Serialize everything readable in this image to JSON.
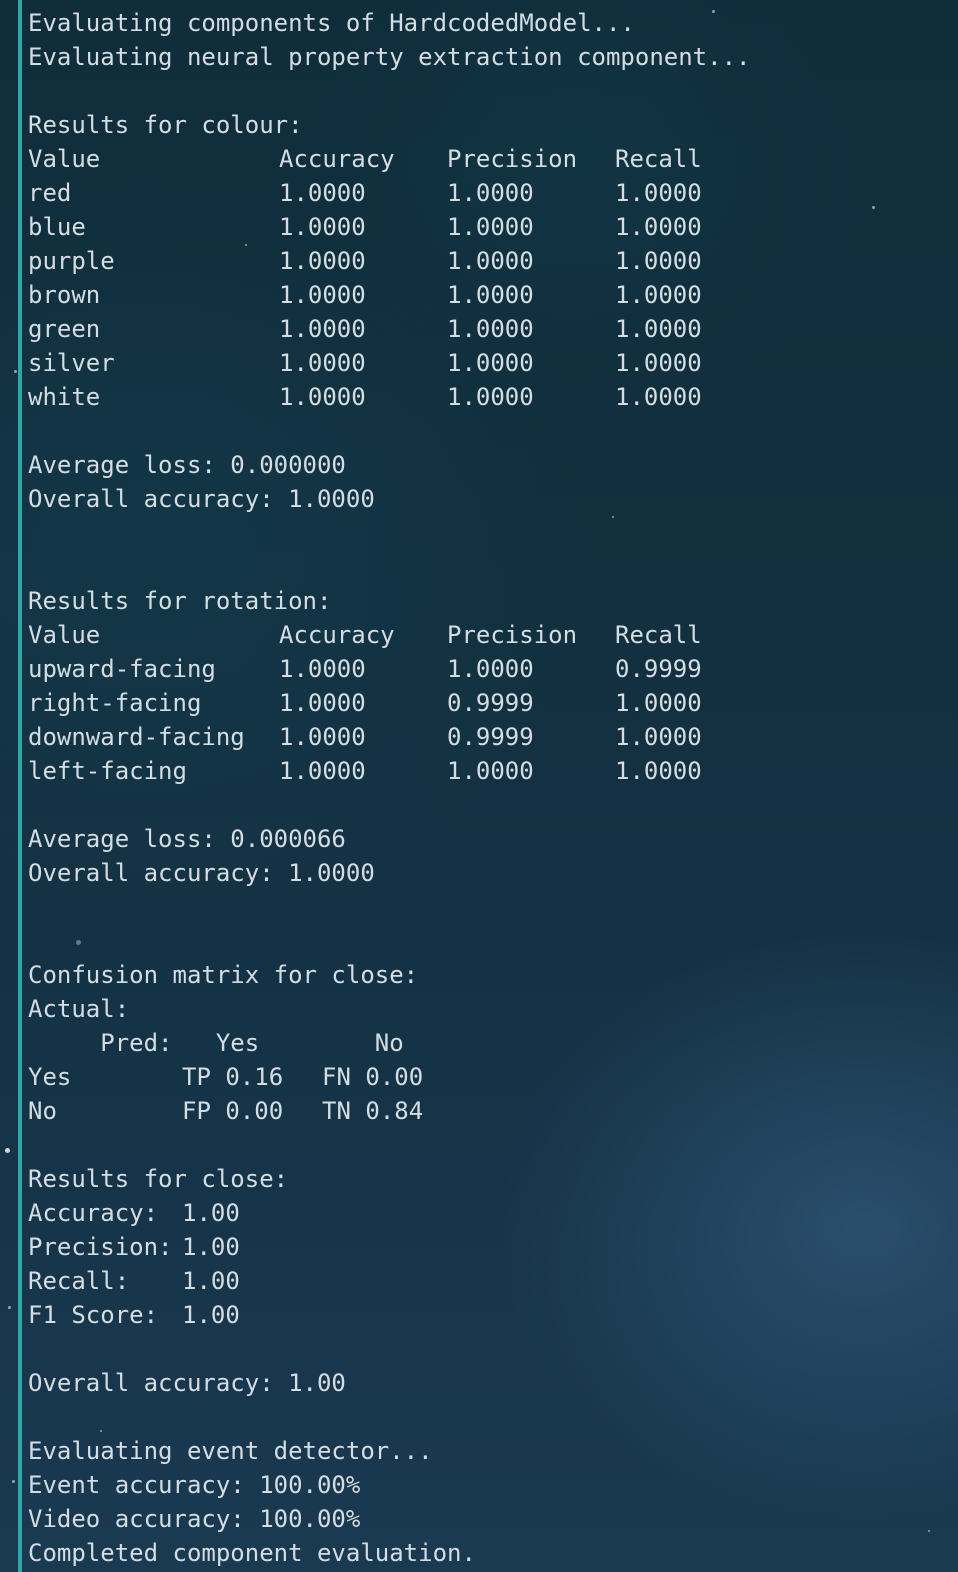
{
  "header": {
    "line1": "Evaluating components of HardcodedModel...",
    "line2": "Evaluating neural property extraction component..."
  },
  "colour": {
    "title": "Results for colour:",
    "columns": [
      "Value",
      "Accuracy",
      "Precision",
      "Recall"
    ],
    "rows": [
      [
        "red",
        "1.0000",
        "1.0000",
        "1.0000"
      ],
      [
        "blue",
        "1.0000",
        "1.0000",
        "1.0000"
      ],
      [
        "purple",
        "1.0000",
        "1.0000",
        "1.0000"
      ],
      [
        "brown",
        "1.0000",
        "1.0000",
        "1.0000"
      ],
      [
        "green",
        "1.0000",
        "1.0000",
        "1.0000"
      ],
      [
        "silver",
        "1.0000",
        "1.0000",
        "1.0000"
      ],
      [
        "white",
        "1.0000",
        "1.0000",
        "1.0000"
      ]
    ],
    "avg_loss": "Average loss: 0.000000",
    "overall": "Overall accuracy: 1.0000"
  },
  "rotation": {
    "title": "Results for rotation:",
    "columns": [
      "Value",
      "Accuracy",
      "Precision",
      "Recall"
    ],
    "rows": [
      [
        "upward-facing",
        "1.0000",
        "1.0000",
        "0.9999"
      ],
      [
        "right-facing",
        "1.0000",
        "0.9999",
        "1.0000"
      ],
      [
        "downward-facing",
        "1.0000",
        "0.9999",
        "1.0000"
      ],
      [
        "left-facing",
        "1.0000",
        "1.0000",
        "1.0000"
      ]
    ],
    "avg_loss": "Average loss: 0.000066",
    "overall": "Overall accuracy: 1.0000"
  },
  "confusion": {
    "title": "Confusion matrix for close:",
    "actual": "Actual:",
    "pred_header": "     Pred:   Yes        No",
    "rows": [
      [
        "Yes",
        "TP 0.16",
        "FN 0.00"
      ],
      [
        "No",
        "FP 0.00",
        "TN 0.84"
      ]
    ]
  },
  "close": {
    "title": "Results for close:",
    "metrics": [
      [
        "Accuracy:",
        "1.00"
      ],
      [
        "Precision:",
        "1.00"
      ],
      [
        "Recall:",
        "1.00"
      ],
      [
        "F1 Score:",
        "1.00"
      ]
    ],
    "overall": "Overall accuracy: 1.00"
  },
  "events": {
    "line1": "Evaluating event detector...",
    "line2": "Event accuracy: 100.00%",
    "line3": "Video accuracy: 100.00%",
    "line4": "Completed component evaluation."
  }
}
